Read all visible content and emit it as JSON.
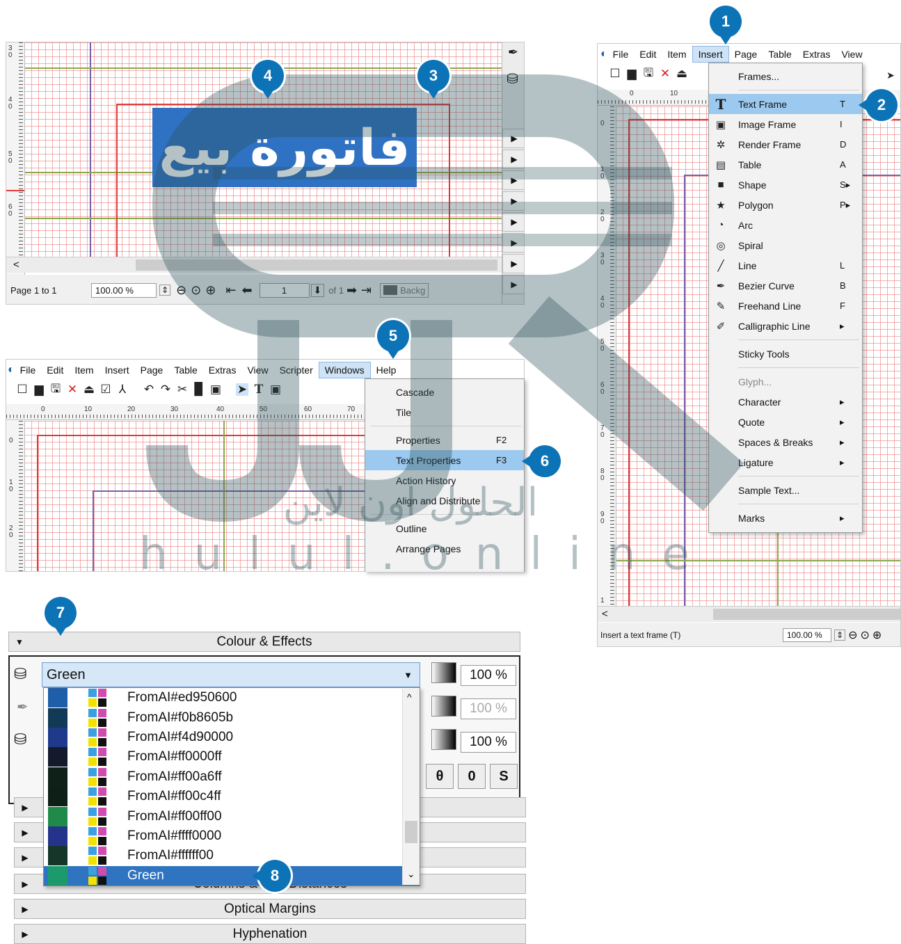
{
  "badges": [
    "1",
    "2",
    "3",
    "4",
    "5",
    "6",
    "7",
    "8"
  ],
  "panel_a": {
    "ruler_nums": [
      "3\n0",
      "4\n0",
      "5\n0",
      "6\n0"
    ],
    "arabic_text": "فاتورة بيع",
    "scroll_left": "<",
    "status": {
      "page": "Page 1 to 1",
      "zoom": "100.00 %",
      "page_num": "1",
      "of": "of 1",
      "layer": "Backg"
    },
    "side_arrows": [
      "▶",
      "▶",
      "▶",
      "▶",
      "▶",
      "▶",
      "▶",
      "▶"
    ]
  },
  "panel_b": {
    "menus": [
      "File",
      "Edit",
      "Item",
      "Insert",
      "Page",
      "Table",
      "Extras",
      "View"
    ],
    "active_menu": "Insert",
    "ruler_top": [
      "0",
      "10"
    ],
    "ruler_left": [
      "0",
      "1\n0",
      "2\n0",
      "3\n0",
      "4\n0",
      "5\n0",
      "6\n0",
      "7\n0",
      "8\n0",
      "9\n0",
      "1"
    ],
    "status_text": "Insert a text frame (T)",
    "zoom": "100.00 %",
    "scroll_left": "<",
    "insert_menu": [
      {
        "label": "Frames...",
        "shortcut": "",
        "icon": ""
      },
      {
        "sep": true
      },
      {
        "label": "Text Frame",
        "shortcut": "T",
        "icon": "T",
        "hl": true
      },
      {
        "label": "Image Frame",
        "shortcut": "I",
        "icon": "▣"
      },
      {
        "label": "Render Frame",
        "shortcut": "D",
        "icon": "✲"
      },
      {
        "label": "Table",
        "shortcut": "A",
        "icon": "▤"
      },
      {
        "label": "Shape",
        "shortcut": "S▸",
        "icon": "■"
      },
      {
        "label": "Polygon",
        "shortcut": "P▸",
        "icon": "★"
      },
      {
        "label": "Arc",
        "shortcut": "",
        "icon": "◔"
      },
      {
        "label": "Spiral",
        "shortcut": "",
        "icon": "◎"
      },
      {
        "label": "Line",
        "shortcut": "L",
        "icon": "╱"
      },
      {
        "label": "Bezier Curve",
        "shortcut": "B",
        "icon": "✒"
      },
      {
        "label": "Freehand Line",
        "shortcut": "F",
        "icon": "✎"
      },
      {
        "label": "Calligraphic Line",
        "shortcut": "▸",
        "icon": "✐"
      },
      {
        "sep": true
      },
      {
        "label": "Sticky Tools",
        "shortcut": "",
        "icon": ""
      },
      {
        "sep": true
      },
      {
        "label": "Glyph...",
        "shortcut": "",
        "icon": "",
        "dis": true
      },
      {
        "label": "Character",
        "shortcut": "▸",
        "icon": ""
      },
      {
        "label": "Quote",
        "shortcut": "▸",
        "icon": ""
      },
      {
        "label": "Spaces & Breaks",
        "shortcut": "▸",
        "icon": ""
      },
      {
        "label": "Ligature",
        "shortcut": "▸",
        "icon": ""
      },
      {
        "sep": true
      },
      {
        "label": "Sample Text...",
        "shortcut": "",
        "icon": ""
      },
      {
        "sep": true
      },
      {
        "label": "Marks",
        "shortcut": "▸",
        "icon": ""
      }
    ]
  },
  "panel_c": {
    "menus": [
      "File",
      "Edit",
      "Item",
      "Insert",
      "Page",
      "Table",
      "Extras",
      "View",
      "Scripter",
      "Windows",
      "Help"
    ],
    "active_menu": "Windows",
    "ruler_top": [
      "0",
      "10",
      "20",
      "30",
      "40",
      "50",
      "60",
      "70"
    ],
    "ruler_left": [
      "0",
      "1\n0",
      "2\n0"
    ],
    "windows_menu": [
      {
        "label": "Cascade",
        "shortcut": ""
      },
      {
        "label": "Tile",
        "shortcut": ""
      },
      {
        "sep": true
      },
      {
        "label": "Properties",
        "shortcut": "F2"
      },
      {
        "label": "Text Properties",
        "shortcut": "F3",
        "hl": true
      },
      {
        "label": "Action History",
        "shortcut": ""
      },
      {
        "label": "Align and Distribute",
        "shortcut": ""
      },
      {
        "sep": true
      },
      {
        "label": "Outline",
        "shortcut": ""
      },
      {
        "label": "Arrange Pages",
        "shortcut": ""
      }
    ]
  },
  "panel_d": {
    "section_title": "Colour & Effects",
    "selected_color": "Green",
    "percents": [
      "100 %",
      "100 %",
      "100 %"
    ],
    "buttons": [
      "θ",
      "0",
      "S"
    ],
    "colors": [
      {
        "name": "FromAI#ed950600",
        "swatch": "#1f5ea8"
      },
      {
        "name": "FromAI#f0b8605b",
        "swatch": "#103a55"
      },
      {
        "name": "FromAI#f4d90000",
        "swatch": "#1f3a8a"
      },
      {
        "name": "FromAI#ff0000ff",
        "swatch": "#121a2c"
      },
      {
        "name": "FromAI#ff00a6ff",
        "swatch": "#0f2018"
      },
      {
        "name": "FromAI#ff00c4ff",
        "swatch": "#0e1f17"
      },
      {
        "name": "FromAI#ff00ff00",
        "swatch": "#1f8a4a"
      },
      {
        "name": "FromAI#ffff0000",
        "swatch": "#25348a"
      },
      {
        "name": "FromAI#ffffff00",
        "swatch": "#16362a"
      },
      {
        "name": "Green",
        "swatch": "#1c9a6c",
        "hl": true
      }
    ],
    "sections": [
      "Columns & Text Distances",
      "Optical Margins",
      "Hyphenation"
    ],
    "hidden_sections": [
      "",
      "",
      ""
    ]
  },
  "watermark": {
    "text": "hulul.online",
    "arabic": "الحلول اون لاين"
  }
}
